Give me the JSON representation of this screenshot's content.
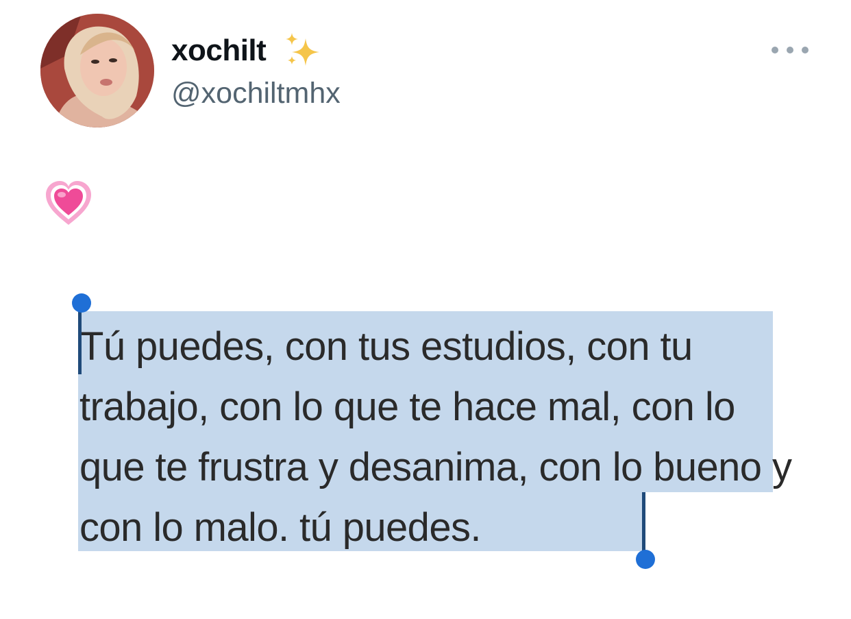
{
  "tweet": {
    "display_name": "xochilt",
    "handle": "@xochiltmhx",
    "name_emoji": "sparkles-icon",
    "body_emoji": "growing-heart-icon"
  },
  "post_image": {
    "text": "Tú puedes, con tus estudios, con tu trabajo, con lo que te hace mal, con lo que te frustra y desanima, con lo bueno y con lo malo. tú puedes.",
    "selection_color": "#c5d8ec",
    "handle_color": "#1f6fd6"
  },
  "icons": {
    "more": "more-horizontal-icon"
  }
}
